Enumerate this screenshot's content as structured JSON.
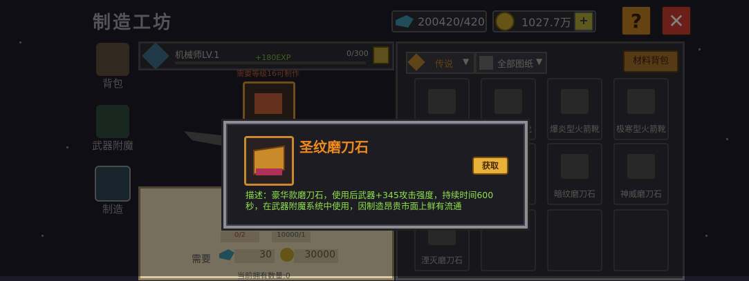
{
  "header": {
    "title": "制造工坊",
    "gems": "200420/420",
    "gold": "1027.7万",
    "add_label": "+",
    "help_label": "?",
    "close_label": "✕"
  },
  "sidebar": {
    "items": [
      {
        "label": "背包"
      },
      {
        "label": "武器附魔"
      },
      {
        "label": "制造"
      }
    ]
  },
  "craft": {
    "profession": "机械师LV.1",
    "exp_gain": "+180EXP",
    "exp_progress": "0/300",
    "exp_fraction": 0,
    "requirement": "需要等级16可制作",
    "count_a": "0/2",
    "count_b": "10000/1",
    "need_label": "需要",
    "need_gems": "30",
    "need_gold": "30000",
    "owned_label": "当前拥有数量:0"
  },
  "filters": {
    "rarity": "传说",
    "blueprints": "全部图纸",
    "bag_button": "材料背包"
  },
  "grid": {
    "items": [
      {
        "label": ""
      },
      {
        "label": ""
      },
      {
        "label": "爆炎型火箭靴"
      },
      {
        "label": "极寒型火箭靴"
      },
      {
        "label": ""
      },
      {
        "label": ""
      },
      {
        "label": "暗纹磨刀石"
      },
      {
        "label": "神威磨刀石"
      },
      {
        "label": "湮灭磨刀石"
      },
      {
        "label": ""
      },
      {
        "label": ""
      },
      {
        "label": ""
      }
    ],
    "partial_label": "靴"
  },
  "modal": {
    "title": "圣纹磨刀石",
    "get_button": "获取",
    "description": "描述：豪华款磨刀石，使用后武器+345攻击强度，持续时间600秒，在武器附魔系统中使用，因制造昂贵市面上鲜有流通"
  },
  "colors": {
    "title_orange": "#f08a18",
    "desc_green": "#8de04a",
    "button_gold": "#e9b03a",
    "close_red": "#c23a2e"
  }
}
